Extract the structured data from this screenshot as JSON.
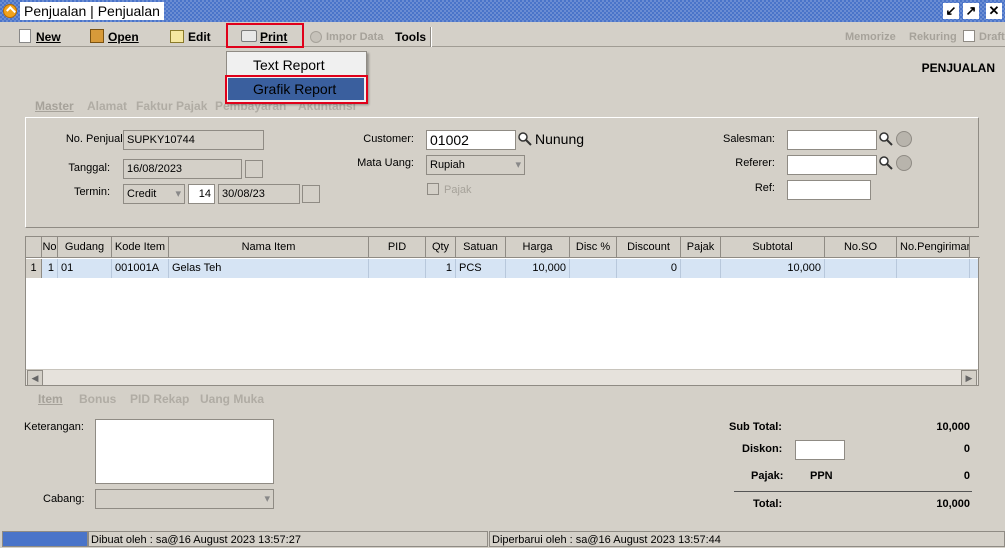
{
  "window": {
    "title": "Penjualan | Penjualan"
  },
  "toolbar": {
    "new": "New",
    "open": "Open",
    "edit": "Edit",
    "print": "Print",
    "import": "Impor Data",
    "tools": "Tools",
    "memorize": "Memorize",
    "recurring": "Rekuring",
    "draft": "Draft"
  },
  "menu": {
    "items": [
      "Text Report",
      "Grafik Report"
    ],
    "highlighted": "Grafik Report"
  },
  "section_title": "PENJUALAN",
  "tabs": [
    "Master",
    "Alamat",
    "Faktur Pajak",
    "Pembayaran",
    "Akuntansi"
  ],
  "master": {
    "no_penjualan_label": "No. Penjualan:",
    "no_penjualan": "SUPKY10744",
    "tanggal_label": "Tanggal:",
    "tanggal": "16/08/2023",
    "termin_label": "Termin:",
    "termin": "Credit",
    "termin_days": "14",
    "termin_date": "30/08/23",
    "customer_label": "Customer:",
    "customer_code": "01002",
    "customer_name": "Nunung",
    "mata_uang_label": "Mata Uang:",
    "mata_uang": "Rupiah",
    "pajak_label": "Pajak",
    "salesman_label": "Salesman:",
    "referer_label": "Referer:",
    "ref_label": "Ref:"
  },
  "grid": {
    "columns": [
      "No",
      "Gudang",
      "Kode Item",
      "Nama Item",
      "PID",
      "Qty",
      "Satuan",
      "Harga",
      "Disc %",
      "Discount",
      "Pajak",
      "Subtotal",
      "No.SO",
      "No.Pengiriman"
    ],
    "rows": [
      {
        "row_num": "1",
        "no": "1",
        "gudang": "01",
        "kode": "001001A",
        "nama": "Gelas Teh",
        "pid": "",
        "qty": "1",
        "satuan": "PCS",
        "harga": "10,000",
        "disc": "",
        "discount": "0",
        "pajak": "",
        "subtotal": "10,000",
        "so": "",
        "pengiriman": ""
      }
    ]
  },
  "bottom_tabs": [
    "Item",
    "Bonus",
    "PID Rekap",
    "Uang Muka"
  ],
  "footer": {
    "keterangan_label": "Keterangan:",
    "cabang_label": "Cabang:",
    "sub_total_label": "Sub Total:",
    "sub_total": "10,000",
    "diskon_label": "Diskon:",
    "diskon": "0",
    "pajak_label": "Pajak:",
    "pajak_type": "PPN",
    "pajak": "0",
    "total_label": "Total:",
    "total": "10,000"
  },
  "status": {
    "created": "Dibuat oleh : sa@16 August 2023  13:57:27",
    "updated": "Diperbarui oleh : sa@16 August 2023  13:57:44"
  },
  "colors": {
    "titlebar": "#4a74c9",
    "highlight_border": "#e0001a",
    "menu_selected": "#3a5f9e",
    "grid_row": "#d6e4f4"
  }
}
